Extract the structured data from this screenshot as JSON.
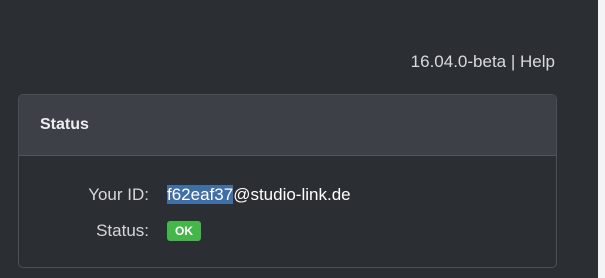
{
  "header": {
    "version": "16.04.0-beta",
    "separator": "|",
    "help_link": "Help"
  },
  "status_panel": {
    "title": "Status",
    "id_label": "Your ID:",
    "id_selected_part": "f62eaf37",
    "id_rest": "@studio-link.de",
    "status_label": "Status:",
    "status_badge": "OK"
  },
  "colors": {
    "background": "#2b2e33",
    "panel_heading": "#3d4047",
    "selection": "#3f6fa4",
    "ok_badge": "#45b649"
  }
}
